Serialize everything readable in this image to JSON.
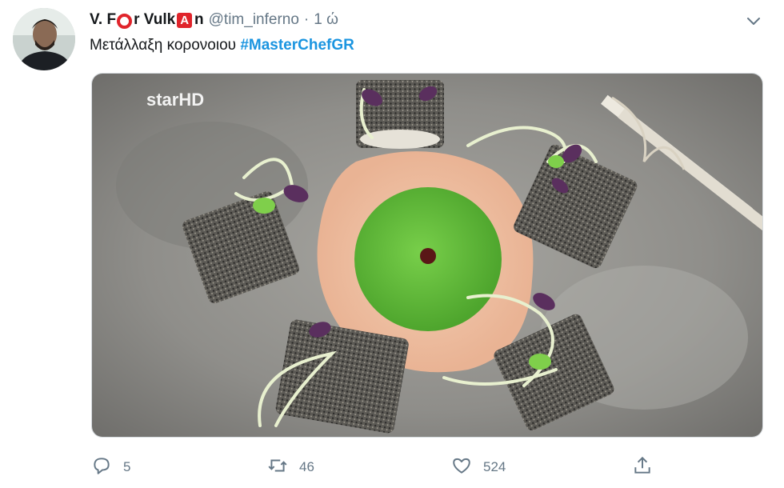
{
  "tweet": {
    "name_parts": [
      "V. F",
      "r Vulk",
      "A",
      "n"
    ],
    "handle": "@tim_inferno",
    "separator": "·",
    "time": "1 ώ",
    "text": "Μετάλλαξη κορονοιου",
    "hashtag": "#MasterChefGR"
  },
  "media": {
    "watermark": "starHD"
  },
  "actions": {
    "replies": "5",
    "retweets": "46",
    "likes": "524"
  },
  "colors": {
    "link": "#1b95e0",
    "muted": "#657786",
    "brand_red": "#e0242b"
  },
  "icons": [
    "caret-down-icon",
    "reply-icon",
    "retweet-icon",
    "like-icon",
    "share-icon"
  ]
}
